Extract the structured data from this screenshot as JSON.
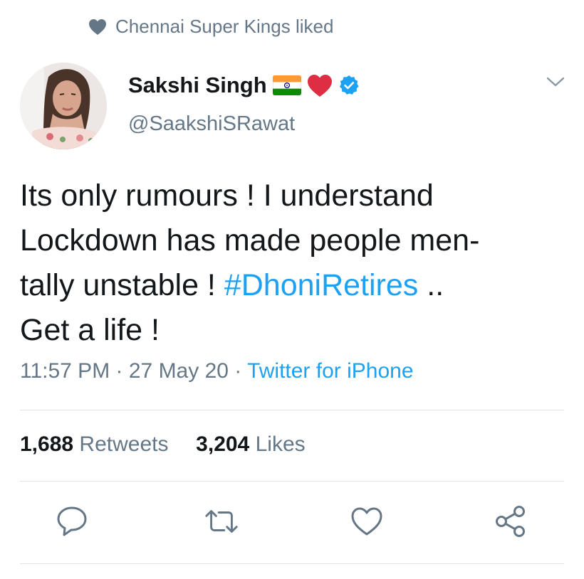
{
  "social_context": {
    "text": "Chennai Super Kings liked",
    "icon": "heart-filled-icon"
  },
  "author": {
    "display_name": "Sakshi Singh",
    "emojis": [
      "india-flag-emoji",
      "red-heart-emoji"
    ],
    "verified": true,
    "handle": "@SaakshiSRawat"
  },
  "tweet": {
    "lines": [
      {
        "text": "Its only rumours ! I understand"
      },
      {
        "text": "Lockdown has made people men-"
      },
      {
        "text": "tally unstable ! ",
        "hashtag": "#DhoniRetires",
        "after": " .."
      },
      {
        "text": "Get a life !"
      }
    ]
  },
  "meta": {
    "time": "11:57 PM",
    "separator": " · ",
    "date": "27 May 20",
    "source": "Twitter for iPhone"
  },
  "stats": {
    "retweets_count": "1,688",
    "retweets_label": "Retweets",
    "likes_count": "3,204",
    "likes_label": "Likes"
  },
  "actions": [
    "reply-icon",
    "retweet-icon",
    "like-icon",
    "share-icon"
  ],
  "colors": {
    "link": "#1da1f2",
    "secondary_text": "#657786",
    "primary_text": "#14171a",
    "divider": "#dfe3e6",
    "heart_red": "#e0245e"
  }
}
